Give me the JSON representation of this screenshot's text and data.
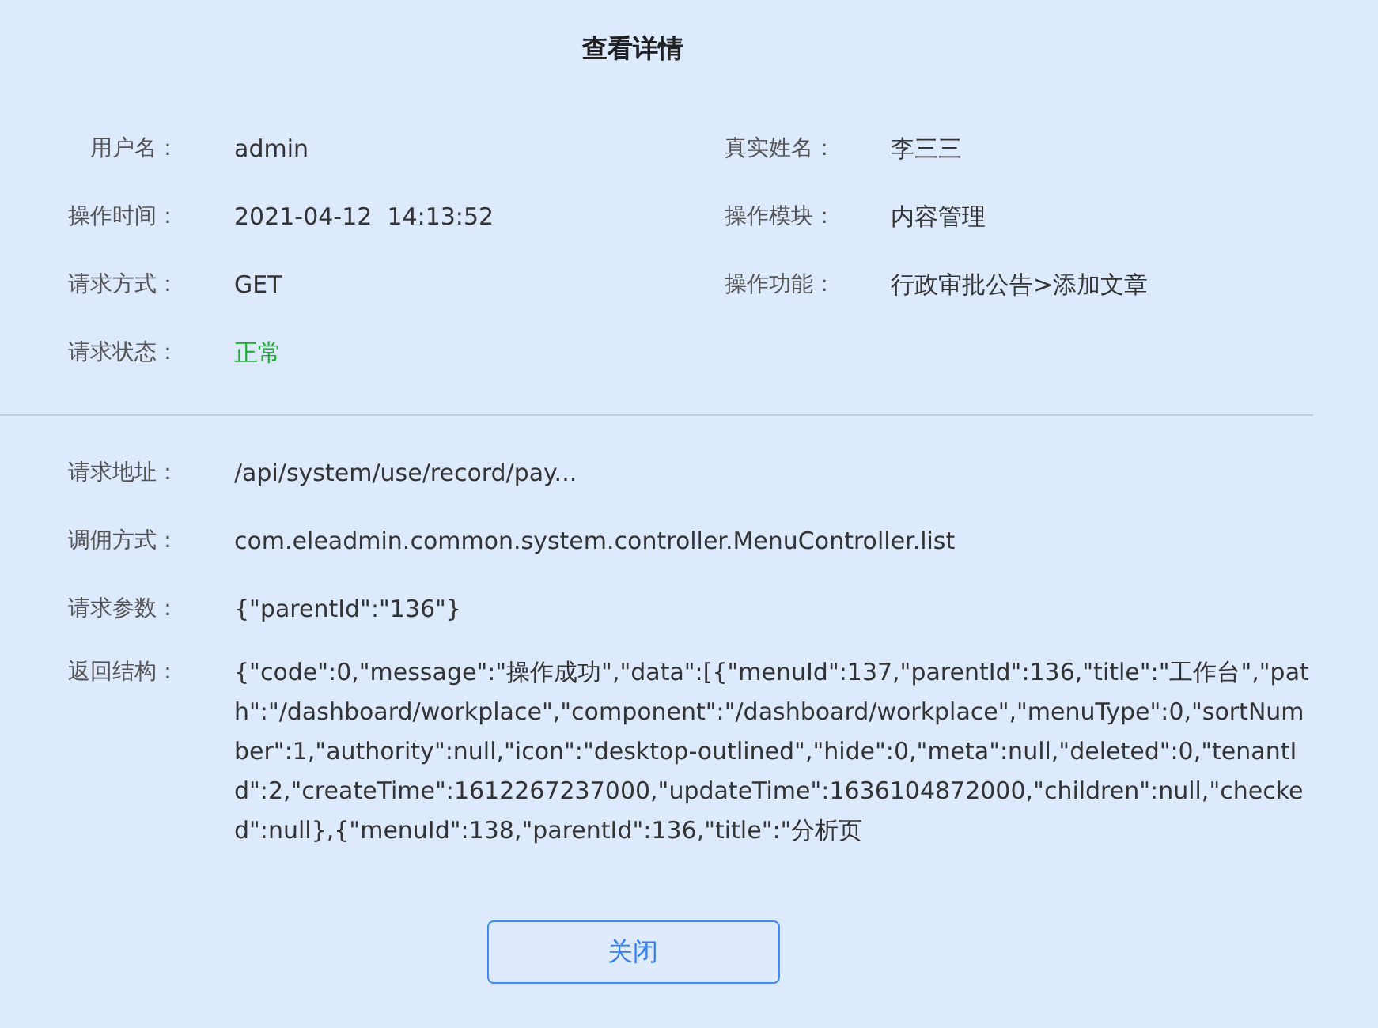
{
  "dialog": {
    "title": "查看详情"
  },
  "summary_fields": [
    {
      "label": "用户名：",
      "value": "admin",
      "kind": "text"
    },
    {
      "label": "真实姓名：",
      "value": "李三三",
      "kind": "text"
    },
    {
      "label": "操作时间：",
      "value": "2021-04-12  14:13:52",
      "kind": "text"
    },
    {
      "label": "操作模块：",
      "value": "内容管理",
      "kind": "text"
    },
    {
      "label": "请求方式：",
      "value": "GET",
      "kind": "text"
    },
    {
      "label": "操作功能：",
      "value": "行政审批公告>添加文章",
      "kind": "text"
    },
    {
      "label": "请求状态：",
      "value": "正常",
      "kind": "status"
    }
  ],
  "detail_fields": [
    {
      "label": "请求地址：",
      "value": "/api/system/use/record/pay...",
      "kind": "text"
    },
    {
      "label": "调佣方式：",
      "value": "com.eleadmin.common.system.controller.MenuController.list",
      "kind": "text"
    },
    {
      "label": "请求参数：",
      "value": "{\"parentId\":\"136\"}",
      "kind": "text"
    },
    {
      "label": "返回结构：",
      "value": "{\"code\":0,\"message\":\"操作成功\",\"data\":[{\"menuId\":137,\"parentId\":136,\"title\":\"工作台\",\"path\":\"/dashboard/workplace\",\"component\":\"/dashboard/workplace\",\"menuType\":0,\"sortNumber\":1,\"authority\":null,\"icon\":\"desktop-outlined\",\"hide\":0,\"meta\":null,\"deleted\":0,\"tenantId\":2,\"createTime\":1612267237000,\"updateTime\":1636104872000,\"children\":null,\"checked\":null},{\"menuId\":138,\"parentId\":136,\"title\":\"分析页",
      "kind": "block"
    }
  ],
  "buttons": [
    {
      "label": "关闭"
    }
  ]
}
